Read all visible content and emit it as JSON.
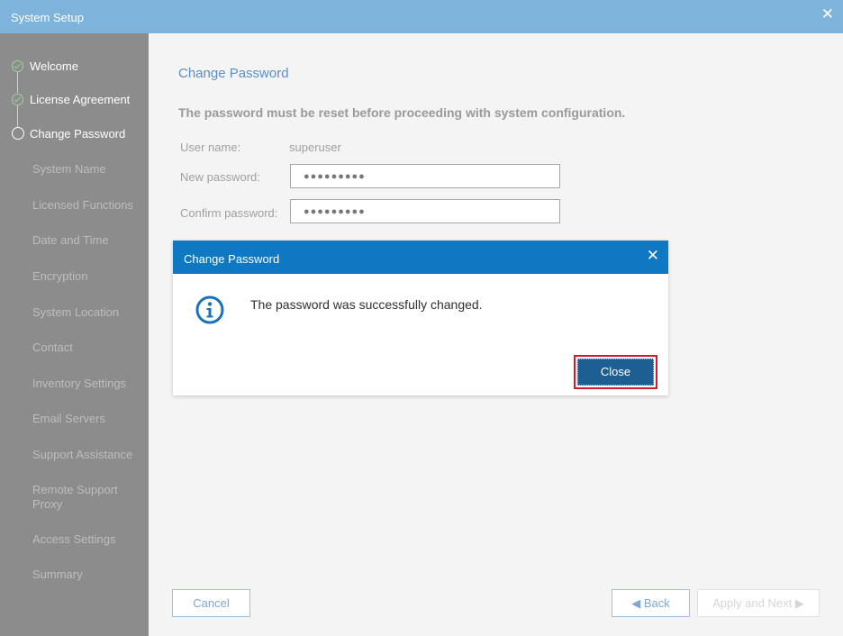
{
  "window": {
    "title": "System Setup",
    "close_glyph": "✕",
    "close_icon": "close-icon"
  },
  "sidebar": {
    "steps": [
      {
        "label": "Welcome",
        "state": "done",
        "icon": "check-circle-icon"
      },
      {
        "label": "License Agreement",
        "state": "done",
        "icon": "check-circle-icon"
      },
      {
        "label": "Change Password",
        "state": "current",
        "icon": "ring-icon"
      },
      {
        "label": "System Name",
        "state": "pending"
      },
      {
        "label": "Licensed Functions",
        "state": "pending"
      },
      {
        "label": "Date and Time",
        "state": "pending"
      },
      {
        "label": "Encryption",
        "state": "pending"
      },
      {
        "label": "System Location",
        "state": "pending"
      },
      {
        "label": "Contact",
        "state": "pending"
      },
      {
        "label": "Inventory Settings",
        "state": "pending"
      },
      {
        "label": "Email Servers",
        "state": "pending"
      },
      {
        "label": "Support Assistance",
        "state": "pending"
      },
      {
        "label": "Remote Support Proxy",
        "state": "pending"
      },
      {
        "label": "Access Settings",
        "state": "pending"
      },
      {
        "label": "Summary",
        "state": "pending"
      }
    ]
  },
  "main": {
    "page_title": "Change Password",
    "instruction": "The password must be reset before proceeding with system configuration.",
    "fields": {
      "username_label": "User name:",
      "username_value": "superuser",
      "new_password_label": "New password:",
      "new_password_value": "●●●●●●●●●",
      "confirm_password_label": "Confirm password:",
      "confirm_password_value": "●●●●●●●●●"
    }
  },
  "footer": {
    "cancel": "Cancel",
    "back": "◀ Back",
    "next": "Apply and Next ▶"
  },
  "dialog": {
    "title": "Change Password",
    "close_glyph": "✕",
    "message": "The password was successfully changed.",
    "close_button": "Close",
    "icon": "info-icon"
  },
  "colors": {
    "titlebar": "#7eb3dc",
    "dialog_header": "#0f78c2",
    "primary_button": "#1d5f92",
    "highlight_border": "#d01c2c",
    "sidebar": "#8c8c8c"
  }
}
